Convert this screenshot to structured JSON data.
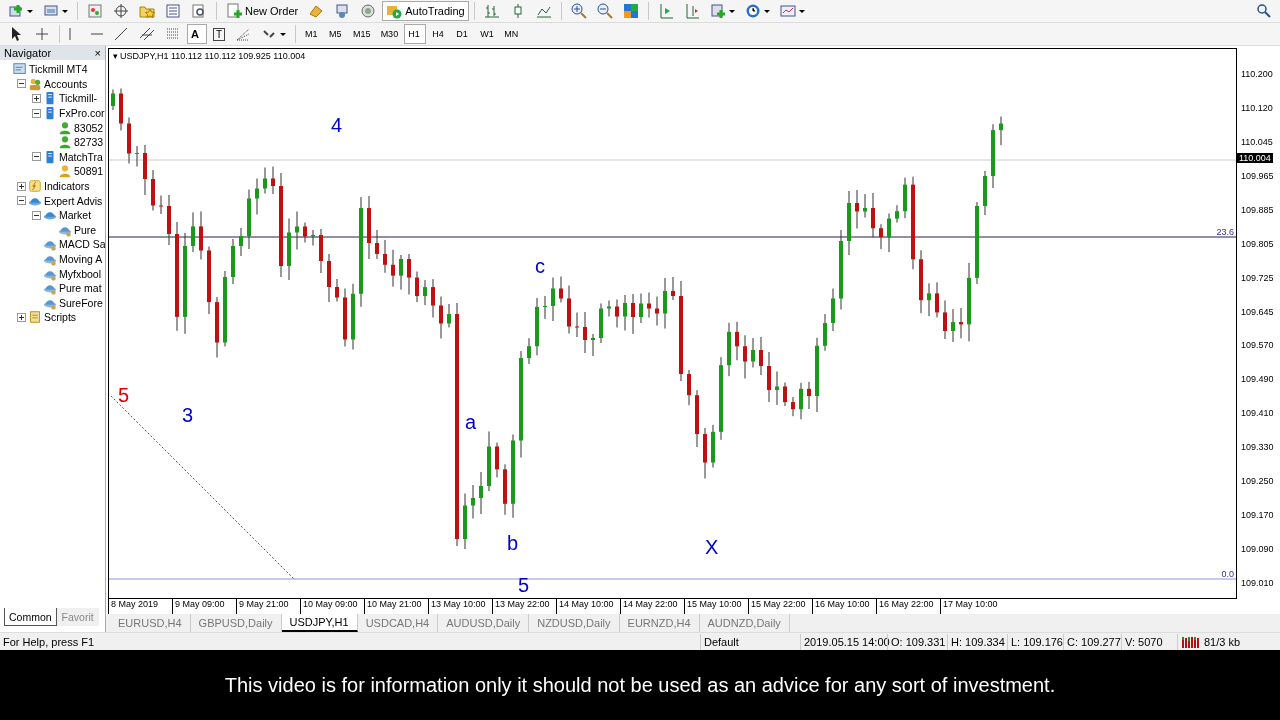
{
  "toolbar": {
    "new_order": "New Order",
    "autotrading": "AutoTrading",
    "text_tool": "A",
    "label_tool": "T"
  },
  "timeframes": [
    {
      "label": "M1",
      "selected": false
    },
    {
      "label": "M5",
      "selected": false
    },
    {
      "label": "M15",
      "selected": false
    },
    {
      "label": "M30",
      "selected": false
    },
    {
      "label": "H1",
      "selected": true
    },
    {
      "label": "H4",
      "selected": false
    },
    {
      "label": "D1",
      "selected": false
    },
    {
      "label": "W1",
      "selected": false
    },
    {
      "label": "MN",
      "selected": false
    }
  ],
  "navigator": {
    "title": "Navigator",
    "close": "×",
    "tree": [
      {
        "label": "Tickmill MT4",
        "kind": "terminal",
        "children": [
          {
            "label": "Accounts",
            "kind": "accounts",
            "expanded": true,
            "children": [
              {
                "label": "Tickmill-",
                "kind": "server",
                "expanded": false
              },
              {
                "label": "FxPro.cor",
                "kind": "server",
                "expanded": true,
                "children": [
                  {
                    "label": "83052",
                    "kind": "real-account"
                  },
                  {
                    "label": "82733",
                    "kind": "real-account"
                  }
                ]
              },
              {
                "label": "MatchTra",
                "kind": "server",
                "expanded": true,
                "children": [
                  {
                    "label": "50891",
                    "kind": "demo-account"
                  }
                ]
              }
            ]
          },
          {
            "label": "Indicators",
            "kind": "indicators",
            "expanded": false
          },
          {
            "label": "Expert Advis",
            "kind": "experts",
            "expanded": true,
            "children": [
              {
                "label": "Market",
                "kind": "market",
                "expanded": true,
                "children": [
                  {
                    "label": "Pure",
                    "kind": "expert"
                  }
                ]
              },
              {
                "label": "MACD Sa",
                "kind": "expert"
              },
              {
                "label": "Moving A",
                "kind": "expert"
              },
              {
                "label": "Myfxbool",
                "kind": "expert"
              },
              {
                "label": "Pure mat",
                "kind": "expert"
              },
              {
                "label": "SureFore",
                "kind": "expert"
              }
            ]
          },
          {
            "label": "Scripts",
            "kind": "scripts",
            "expanded": false
          }
        ]
      }
    ],
    "tabs": [
      {
        "label": "Common",
        "selected": true
      },
      {
        "label": "Favorit",
        "selected": false
      }
    ]
  },
  "chart": {
    "header_toggle": "▾",
    "header": "USDJPY,H1  110.112 110.112 109.925 110.004",
    "price_ticks": [
      "110.200",
      "110.120",
      "110.045",
      "109.965",
      "109.885",
      "109.805",
      "109.725",
      "109.645",
      "109.570",
      "109.490",
      "109.410",
      "109.330",
      "109.250",
      "109.170",
      "109.090",
      "109.010"
    ],
    "current_price": "110.004",
    "fib_levels": [
      "23.6",
      "0.0"
    ],
    "wave_labels": [
      {
        "text": "4",
        "color": "#0000cc"
      },
      {
        "text": "5",
        "color": "#dd0000"
      },
      {
        "text": "3",
        "color": "#0000cc"
      },
      {
        "text": "a",
        "color": "#0000cc"
      },
      {
        "text": "b",
        "color": "#0000cc"
      },
      {
        "text": "c",
        "color": "#0000cc"
      },
      {
        "text": "X",
        "color": "#0000cc"
      },
      {
        "text": "5",
        "color": "#0000cc"
      }
    ],
    "time_labels": [
      "8 May 2019",
      "9 May 09:00",
      "9 May 21:00",
      "10 May 09:00",
      "10 May 21:00",
      "13 May 10:00",
      "13 May 22:00",
      "14 May 10:00",
      "14 May 22:00",
      "15 May 10:00",
      "15 May 22:00",
      "16 May 10:00",
      "16 May 22:00",
      "17 May 10:00"
    ]
  },
  "symbol_tabs": [
    {
      "label": "EURUSD,H4",
      "selected": false
    },
    {
      "label": "GBPUSD,Daily",
      "selected": false
    },
    {
      "label": "USDJPY,H1",
      "selected": true
    },
    {
      "label": "USDCAD,H4",
      "selected": false
    },
    {
      "label": "AUDUSD,Daily",
      "selected": false
    },
    {
      "label": "NZDUSD,Daily",
      "selected": false
    },
    {
      "label": "EURNZD,H4",
      "selected": false
    },
    {
      "label": "AUDNZD,Daily",
      "selected": false
    }
  ],
  "status_bar": {
    "help": "For Help, press F1",
    "profile": "Default",
    "time": "2019.05.15 14:00",
    "open": "O: 109.331",
    "high": "H: 109.334",
    "low": "L: 109.176",
    "close": "C: 109.277",
    "volume": "V: 5070",
    "traffic": "81/3 kb"
  },
  "caption": "This video is for information only it should not be used as an advice for any sort of investment."
}
